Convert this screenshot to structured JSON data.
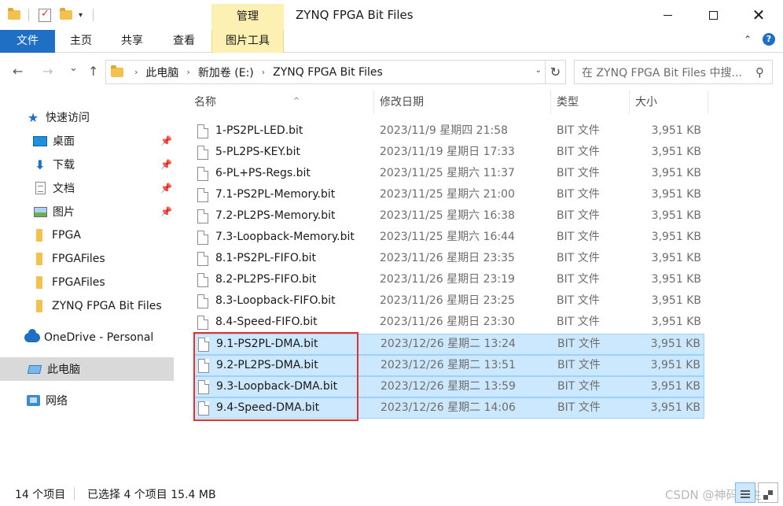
{
  "window": {
    "title": "ZYNQ FPGA Bit Files",
    "context_tab": "管理",
    "qa_arrow": "▾",
    "close_glyph": "✕"
  },
  "ribbon": {
    "file": "文件",
    "home": "主页",
    "share": "共享",
    "view": "查看",
    "picture_tools": "图片工具",
    "accent": "#1f6fc5",
    "context_color": "#fcf1b2"
  },
  "nav": {
    "back": "←",
    "forward": "→",
    "recent": "⌄",
    "up": "↑",
    "breadcrumb": [
      "此电脑",
      "新加卷 (E:)",
      "ZYNQ FPGA Bit Files"
    ],
    "search_placeholder": "在 ZYNQ FPGA Bit Files 中搜..."
  },
  "sidebar": {
    "items": [
      {
        "label": "快速访问",
        "icon": "star-icon",
        "pinned": false
      },
      {
        "label": "桌面",
        "icon": "desktop-icon",
        "pinned": true
      },
      {
        "label": "下载",
        "icon": "download-icon",
        "pinned": true
      },
      {
        "label": "文档",
        "icon": "document-icon",
        "pinned": true
      },
      {
        "label": "图片",
        "icon": "pictures-icon",
        "pinned": true
      },
      {
        "label": "FPGA",
        "icon": "folder-icon",
        "pinned": false
      },
      {
        "label": "FPGAFiles",
        "icon": "folder-icon",
        "pinned": false
      },
      {
        "label": "FPGAFiles",
        "icon": "folder-icon",
        "pinned": false
      },
      {
        "label": "ZYNQ FPGA Bit Files",
        "icon": "folder-icon",
        "pinned": false
      },
      {
        "label": "OneDrive - Personal",
        "icon": "onedrive-icon",
        "pinned": false
      },
      {
        "label": "此电脑",
        "icon": "this-pc-icon",
        "pinned": false,
        "selected": true
      },
      {
        "label": "网络",
        "icon": "network-icon",
        "pinned": false
      }
    ]
  },
  "columns": {
    "name": "名称",
    "date": "修改日期",
    "type": "类型",
    "size": "大小"
  },
  "files": [
    {
      "name": "1-PS2PL-LED.bit",
      "date": "2023/11/9 星期四 21:58",
      "type": "BIT 文件",
      "size": "3,951 KB",
      "selected": false
    },
    {
      "name": "5-PL2PS-KEY.bit",
      "date": "2023/11/19 星期日 17:33",
      "type": "BIT 文件",
      "size": "3,951 KB",
      "selected": false
    },
    {
      "name": "6-PL+PS-Regs.bit",
      "date": "2023/11/25 星期六 11:37",
      "type": "BIT 文件",
      "size": "3,951 KB",
      "selected": false
    },
    {
      "name": "7.1-PS2PL-Memory.bit",
      "date": "2023/11/25 星期六 21:00",
      "type": "BIT 文件",
      "size": "3,951 KB",
      "selected": false
    },
    {
      "name": "7.2-PL2PS-Memory.bit",
      "date": "2023/11/25 星期六 16:38",
      "type": "BIT 文件",
      "size": "3,951 KB",
      "selected": false
    },
    {
      "name": "7.3-Loopback-Memory.bit",
      "date": "2023/11/25 星期六 16:44",
      "type": "BIT 文件",
      "size": "3,951 KB",
      "selected": false
    },
    {
      "name": "8.1-PS2PL-FIFO.bit",
      "date": "2023/11/26 星期日 23:35",
      "type": "BIT 文件",
      "size": "3,951 KB",
      "selected": false
    },
    {
      "name": "8.2-PL2PS-FIFO.bit",
      "date": "2023/11/26 星期日 23:19",
      "type": "BIT 文件",
      "size": "3,951 KB",
      "selected": false
    },
    {
      "name": "8.3-Loopback-FIFO.bit",
      "date": "2023/11/26 星期日 23:25",
      "type": "BIT 文件",
      "size": "3,951 KB",
      "selected": false
    },
    {
      "name": "8.4-Speed-FIFO.bit",
      "date": "2023/11/26 星期日 23:30",
      "type": "BIT 文件",
      "size": "3,951 KB",
      "selected": false
    },
    {
      "name": "9.1-PS2PL-DMA.bit",
      "date": "2023/12/26 星期二 13:24",
      "type": "BIT 文件",
      "size": "3,951 KB",
      "selected": true
    },
    {
      "name": "9.2-PL2PS-DMA.bit",
      "date": "2023/12/26 星期二 13:51",
      "type": "BIT 文件",
      "size": "3,951 KB",
      "selected": true
    },
    {
      "name": "9.3-Loopback-DMA.bit",
      "date": "2023/12/26 星期二 13:59",
      "type": "BIT 文件",
      "size": "3,951 KB",
      "selected": true
    },
    {
      "name": "9.4-Speed-DMA.bit",
      "date": "2023/12/26 星期二 14:06",
      "type": "BIT 文件",
      "size": "3,951 KB",
      "selected": true
    }
  ],
  "status": {
    "count": "14 个项目",
    "selected": "已选择 4 个项目  15.4 MB",
    "watermark": "CSDN @神码人生"
  },
  "colors": {
    "selection_bg": "#cce8ff",
    "selection_border": "#99d1ff",
    "highlight_box": "#e03131"
  }
}
